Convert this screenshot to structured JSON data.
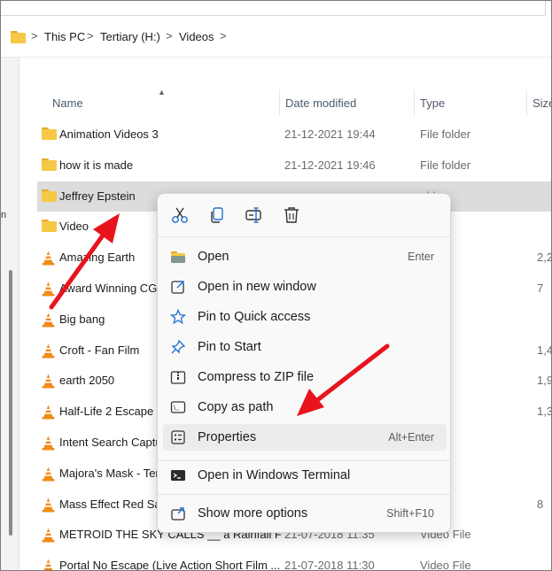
{
  "breadcrumb": {
    "items": [
      "This PC",
      "Tertiary (H:)",
      "Videos"
    ],
    "separator": ">"
  },
  "nav_pane": {
    "partial_letter": "n"
  },
  "columns": {
    "name": "Name",
    "date": "Date modified",
    "type": "Type",
    "size": "Size"
  },
  "rows": [
    {
      "icon": "folder-icon",
      "name": "Animation Videos 3",
      "date": "21-12-2021 19:44",
      "type": "File folder",
      "size": ""
    },
    {
      "icon": "folder-icon",
      "name": "how it is made",
      "date": "21-12-2021 19:46",
      "type": "File folder",
      "size": ""
    },
    {
      "icon": "folder-icon",
      "name": "Jeffrey Epstein",
      "date": "",
      "type": "older",
      "size": "",
      "selected": true
    },
    {
      "icon": "folder-icon",
      "name": "Video",
      "date": "",
      "type": "older",
      "size": ""
    },
    {
      "icon": "vlc-icon",
      "name": "Amazing Earth",
      "date": "",
      "type": "File",
      "size": "2,2"
    },
    {
      "icon": "vlc-icon",
      "name": "Award Winning CGI",
      "date": "",
      "type": "File",
      "size": "7"
    },
    {
      "icon": "vlc-icon",
      "name": "Big bang",
      "date": "",
      "type": "File",
      "size": ""
    },
    {
      "icon": "vlc-icon",
      "name": "Croft - Fan Film",
      "date": "",
      "type": "File",
      "size": "1,4"
    },
    {
      "icon": "vlc-icon",
      "name": "earth 2050",
      "date": "",
      "type": "File",
      "size": "1,9"
    },
    {
      "icon": "vlc-icon",
      "name": "Half-Life 2 Escape F",
      "date": "",
      "type": "File",
      "size": "1,3"
    },
    {
      "icon": "vlc-icon",
      "name": "Intent Search Captu",
      "date": "",
      "type": "File",
      "size": ""
    },
    {
      "icon": "vlc-icon",
      "name": "Majora's Mask - Ter",
      "date": "",
      "type": "File",
      "size": ""
    },
    {
      "icon": "vlc-icon",
      "name": "Mass Effect Red Sar",
      "date": "",
      "type": "File",
      "size": "8"
    },
    {
      "icon": "vlc-icon",
      "name": "METROID THE SKY CALLS __ a Rainfall Fil...",
      "date": "21-07-2018 11:35",
      "type": "Video File",
      "size": ""
    },
    {
      "icon": "vlc-icon",
      "name": "Portal No Escape (Live Action Short Film ...",
      "date": "21-07-2018 11:30",
      "type": "Video File",
      "size": ""
    }
  ],
  "context_menu": {
    "toolbar": [
      {
        "icon": "cut-icon"
      },
      {
        "icon": "copy-icon"
      },
      {
        "icon": "rename-icon"
      },
      {
        "icon": "delete-icon"
      }
    ],
    "items": [
      {
        "icon": "open-folder-icon",
        "label": "Open",
        "shortcut": "Enter"
      },
      {
        "icon": "open-new-window-icon",
        "label": "Open in new window",
        "shortcut": ""
      },
      {
        "icon": "pin-star-icon",
        "label": "Pin to Quick access",
        "shortcut": ""
      },
      {
        "icon": "pin-icon",
        "label": "Pin to Start",
        "shortcut": ""
      },
      {
        "icon": "zip-icon",
        "label": "Compress to ZIP file",
        "shortcut": ""
      },
      {
        "icon": "copy-path-icon",
        "label": "Copy as path",
        "shortcut": ""
      },
      {
        "icon": "properties-icon",
        "label": "Properties",
        "shortcut": "Alt+Enter",
        "highlighted": true
      },
      {
        "icon": "terminal-icon",
        "label": "Open in Windows Terminal",
        "shortcut": ""
      },
      {
        "icon": "show-more-icon",
        "label": "Show more options",
        "shortcut": "Shift+F10"
      }
    ]
  },
  "colors": {
    "arrow": "#e8141d",
    "folder": "#f6c845",
    "vlc_orange": "#f08a19",
    "selection": "#dcdcdc",
    "accent_blue": "#1f6fd1"
  }
}
